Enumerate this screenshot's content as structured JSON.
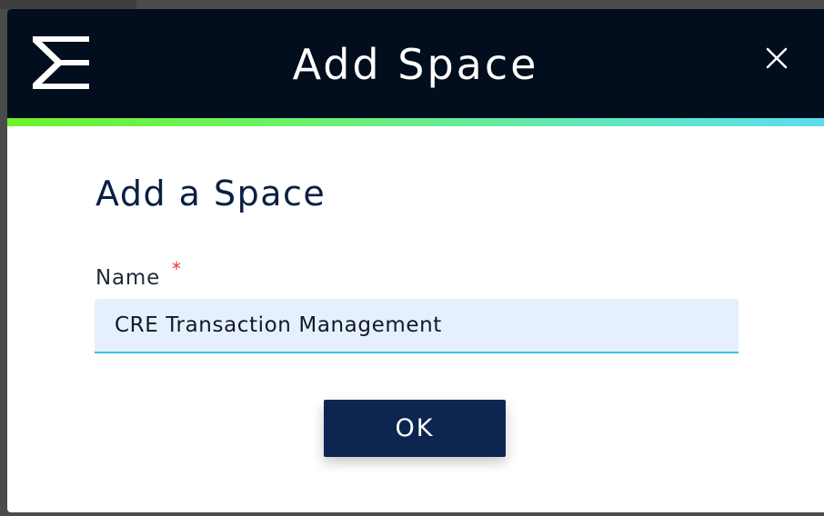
{
  "dialog": {
    "title": "Add Space",
    "close_label": "X",
    "logo_icon": "brand-logo-icon",
    "close_icon": "close-icon"
  },
  "form": {
    "heading": "Add a Space",
    "name_label": "Name",
    "required_marker": "*",
    "name_value": "CRE Transaction Management",
    "submit_label": "OK"
  },
  "colors": {
    "header_background": "#020d1d",
    "accent_gradient_start": "#6ef12a",
    "accent_gradient_end": "#5ddcec",
    "heading_color": "#0a1f44",
    "input_background": "#e6f0fd",
    "input_underline": "#3cbfe8",
    "button_background": "#0d2650",
    "required_color": "#e53935"
  }
}
